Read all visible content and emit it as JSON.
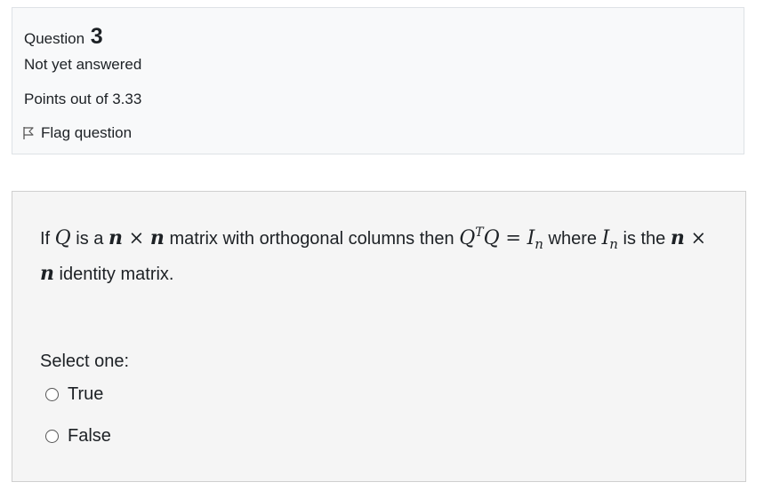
{
  "info": {
    "question_label": "Question",
    "question_number": "3",
    "state": "Not yet answered",
    "grade": "Points out of 3.33",
    "flag_label": "Flag question"
  },
  "question": {
    "text_1": "If ",
    "var_Q": "Q",
    "text_2": " is a ",
    "var_n1": "n",
    "times1": " × ",
    "var_n2": "n",
    "text_3": " matrix with orthogonal columns then ",
    "var_Q2": "Q",
    "sup_T": "T",
    "var_Q3": "Q",
    "eq": " = ",
    "var_I": "I",
    "sub_n": "n",
    "text_4": " where ",
    "var_I2": "I",
    "sub_n2": "n",
    "text_5": " is the ",
    "var_n3": "n",
    "times2": " × ",
    "var_n4": "n",
    "text_6": " identity matrix."
  },
  "answer": {
    "prompt": "Select one:",
    "options": [
      {
        "label": "True"
      },
      {
        "label": "False"
      }
    ]
  }
}
